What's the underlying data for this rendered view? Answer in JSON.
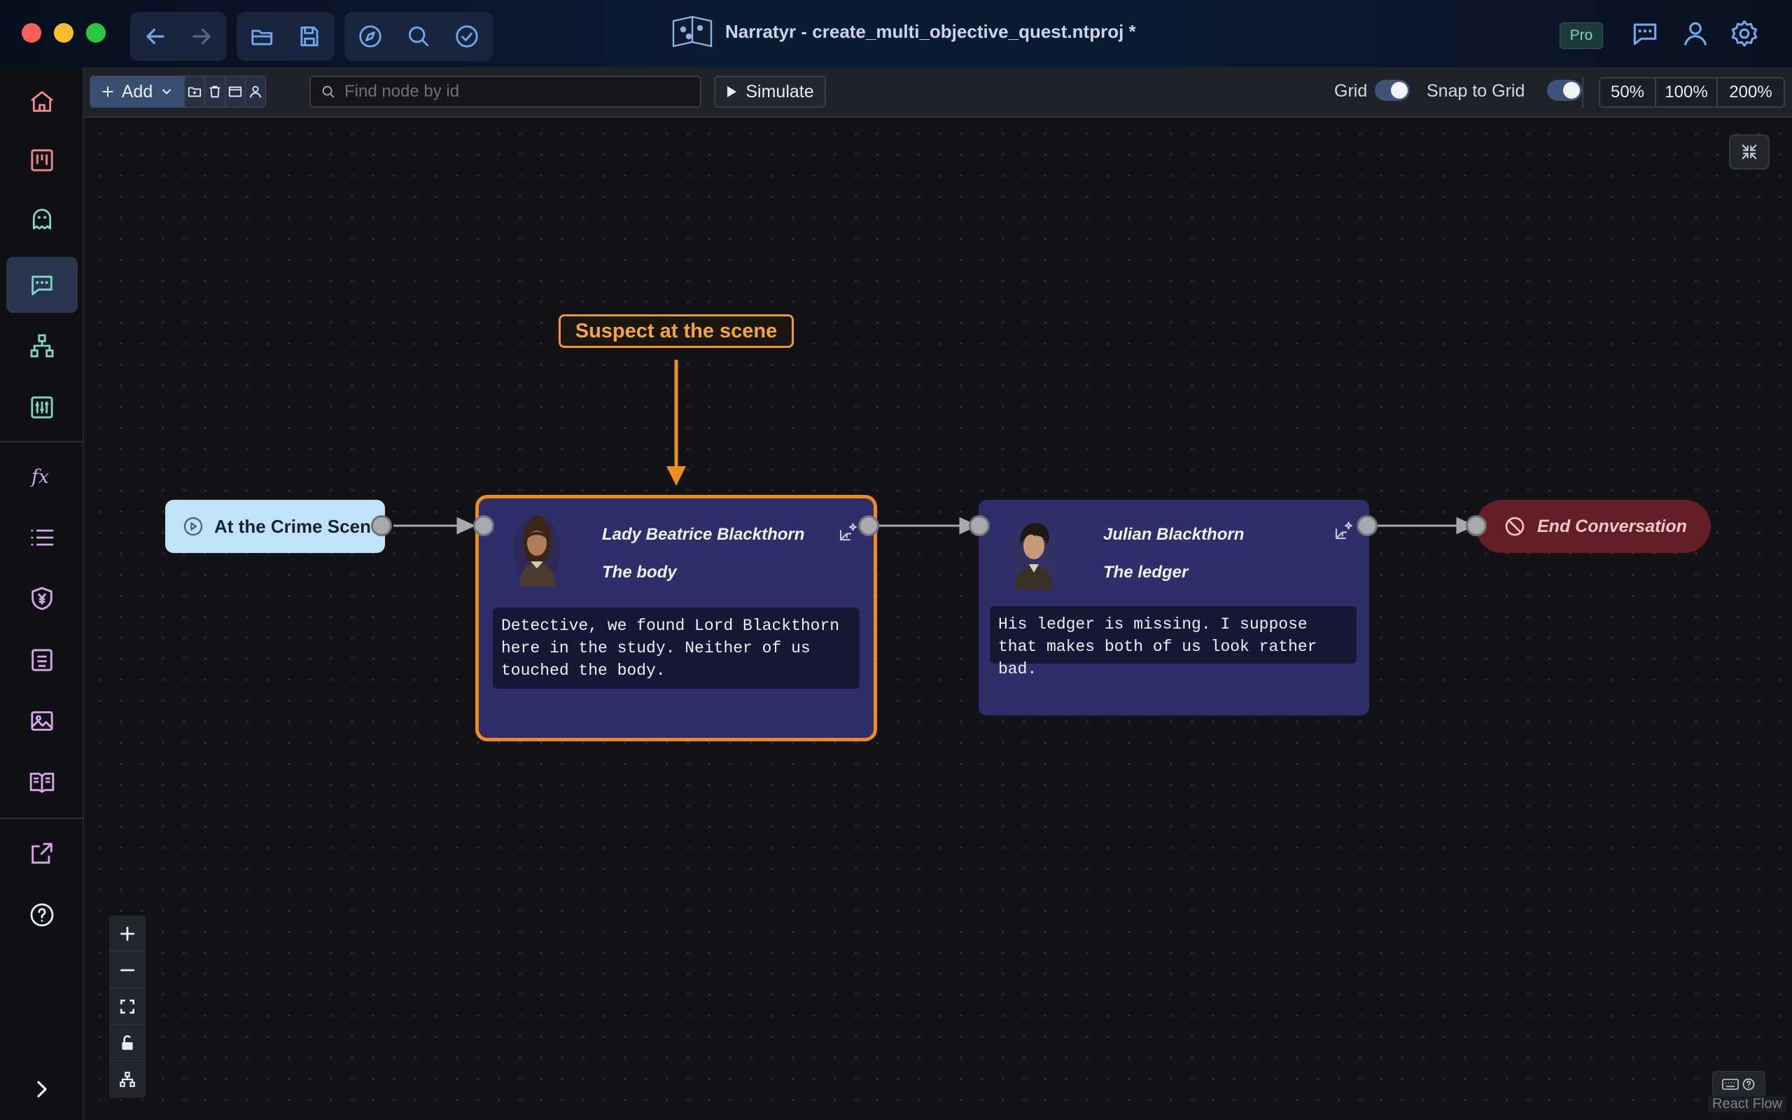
{
  "window": {
    "title": "Narratyr - create_multi_objective_quest.ntproj *",
    "badge": "Pro"
  },
  "toolbar": {
    "add_label": "Add",
    "search_placeholder": "Find node by id",
    "simulate_label": "Simulate",
    "grid_label": "Grid",
    "snap_label": "Snap to Grid",
    "grid_on": true,
    "snap_on": true,
    "zoom_options": [
      "50%",
      "100%",
      "200%"
    ]
  },
  "nodes": {
    "start": {
      "label": "At the Crime Scene"
    },
    "annotation": {
      "label": "Suspect at the scene"
    },
    "dialog1": {
      "speaker": "Lady Beatrice Blackthorn",
      "title": "The body",
      "text": "Detective, we found Lord Blackthorn here in the study. Neither of us touched the body."
    },
    "dialog2": {
      "speaker": "Julian Blackthorn",
      "title": "The ledger",
      "text": "His ledger is missing. I suppose that makes both of us look rather bad."
    },
    "end": {
      "label": "End Conversation"
    }
  },
  "footer": {
    "attribution": "React Flow"
  },
  "colors": {
    "accent_orange": "#ee8c1e",
    "node_blue": "#2e2f6a",
    "start_node": "#bfe3fb",
    "end_node": "#651d26"
  }
}
